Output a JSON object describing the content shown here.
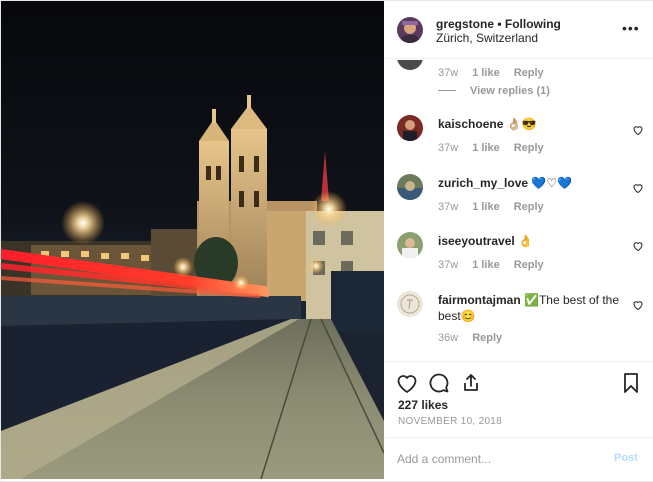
{
  "header": {
    "username": "gregstone",
    "separator": " • ",
    "follow_status": "Following",
    "location": "Zürich, Switzerland",
    "more_label": "•••"
  },
  "comments": {
    "partial": {
      "age": "37w",
      "likes": "1 like",
      "reply": "Reply",
      "view_replies": "View replies (1)"
    },
    "items": [
      {
        "user": "kaischoene",
        "text": "👌🏼😎",
        "age": "37w",
        "likes": "1 like",
        "reply": "Reply"
      },
      {
        "user": "zurich_my_love",
        "text": "💙♡💙",
        "age": "37w",
        "likes": "1 like",
        "reply": "Reply"
      },
      {
        "user": "iseeyoutravel",
        "text": "👌",
        "age": "37w",
        "likes": "1 like",
        "reply": "Reply"
      },
      {
        "user": "fairmontajman",
        "text": "✅The best of the best😊",
        "age": "36w",
        "reply": "Reply"
      }
    ]
  },
  "footer": {
    "likes": "227 likes",
    "date": "NOVEMBER 10, 2018"
  },
  "add_comment": {
    "placeholder": "Add a comment...",
    "post_label": "Post"
  },
  "icons": [
    "heart-icon",
    "comment-icon",
    "share-icon",
    "bookmark-icon",
    "more-icon"
  ],
  "colors": {
    "post_button": "#b3dbff",
    "muted": "#999999",
    "text": "#262626"
  }
}
